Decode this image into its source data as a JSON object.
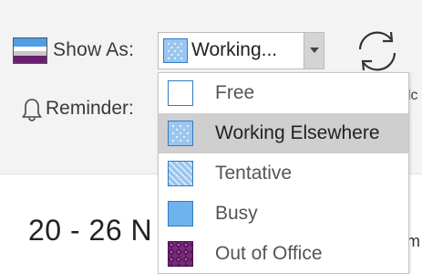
{
  "toolbar": {
    "show_as_label": "Show As:",
    "show_as_icon": "show-as-icon",
    "show_as_value": "Working...",
    "reminder_label": "Reminder:",
    "reminder_icon": "bell-icon",
    "sync_icon": "sync-icon",
    "cut_text": "lc"
  },
  "menu": {
    "items": [
      {
        "label": "Free",
        "status": "free",
        "selected": false
      },
      {
        "label": "Working Elsewhere",
        "status": "working-elsewhere",
        "selected": true
      },
      {
        "label": "Tentative",
        "status": "tentative",
        "selected": false
      },
      {
        "label": "Busy",
        "status": "busy",
        "selected": false
      },
      {
        "label": "Out of Office",
        "status": "out-of-office",
        "selected": false
      }
    ]
  },
  "calendar": {
    "date_range": "20 - 26 N",
    "right_edge_text": "m"
  },
  "colors": {
    "free": "#ffffff",
    "working_elsewhere": "#9bc6ee",
    "tentative": "#9bc6ee",
    "busy": "#6eb2ee",
    "out_of_office": "#7a2a7a",
    "selected_bg": "#cfcfcf"
  }
}
